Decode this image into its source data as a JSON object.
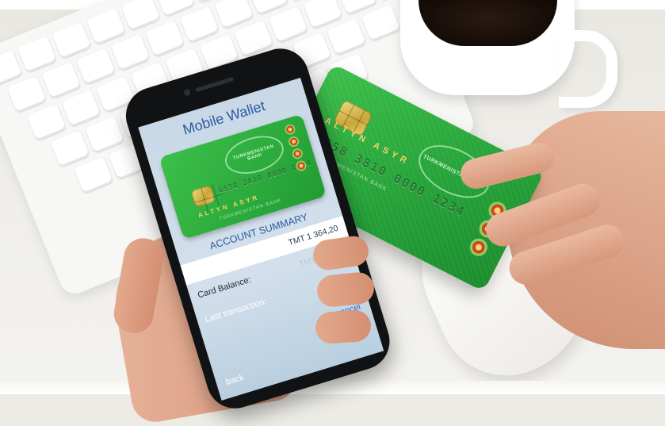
{
  "phone": {
    "app_title": "Mobile Wallet",
    "summary_title": "ACCOUNT SUMMARY",
    "balance_value": "TMT 1 364,20",
    "card_balance_label": "Card Balance:",
    "card_balance_value": "TMT -207,00",
    "last_transaction_label": "Last transaction:",
    "cancel_label": "cancel",
    "back_label": "back"
  },
  "card": {
    "bank_name": "TURKMENISTAN BANK",
    "number": "6558 3810 0000 1234",
    "name": "ALTYN ASYR",
    "subtext": "TURKMENISTAN BANK"
  },
  "colors": {
    "card_green": "#26a339",
    "title_blue": "#2b5c9e",
    "link_blue": "#2b6cc4",
    "gold": "#f4d46a"
  }
}
